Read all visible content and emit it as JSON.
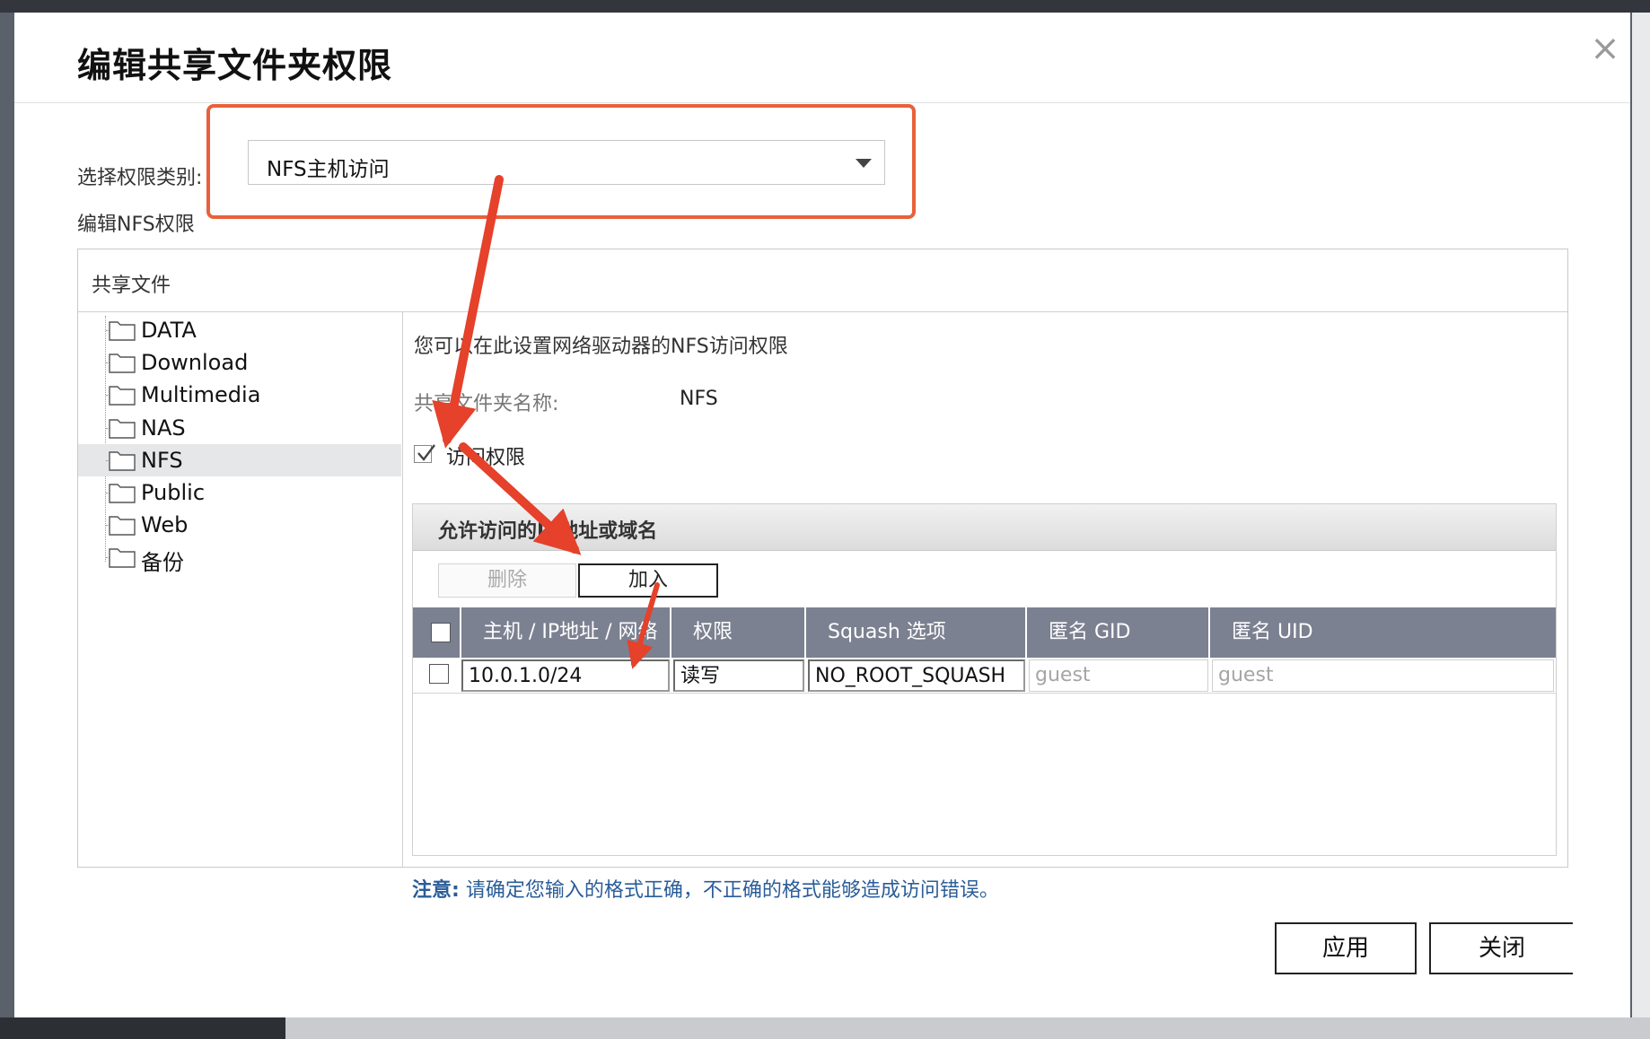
{
  "dialog": {
    "title": "编辑共享文件夹权限",
    "close_glyph": "×"
  },
  "category": {
    "label": "选择权限类别:",
    "selected": "NFS主机访问"
  },
  "edit_label": "编辑NFS权限",
  "panel": {
    "header": "共享文件",
    "folders": [
      {
        "name": "DATA",
        "selected": false
      },
      {
        "name": "Download",
        "selected": false
      },
      {
        "name": "Multimedia",
        "selected": false
      },
      {
        "name": "NAS",
        "selected": false
      },
      {
        "name": "NFS",
        "selected": true
      },
      {
        "name": "Public",
        "selected": false
      },
      {
        "name": "Web",
        "selected": false
      },
      {
        "name": "备份",
        "selected": false
      }
    ]
  },
  "detail": {
    "description": "您可以在此设置网络驱动器的NFS访问权限",
    "share_name_label": "共享文件夹名称:",
    "share_name_value": "NFS",
    "access_checked": true,
    "access_label": "访问权限",
    "allowed_header": "允许访问的IP地址或域名",
    "delete_button": "删除",
    "add_button": "加入",
    "columns": [
      "主机 / IP地址 / 网络",
      "权限",
      "Squash 选项",
      "匿名 GID",
      "匿名 UID"
    ],
    "rows": [
      {
        "host": "10.0.1.0/24",
        "permission": "读写",
        "squash": "NO_ROOT_SQUASH",
        "gid_placeholder": "guest",
        "uid_placeholder": "guest"
      }
    ],
    "note_prefix": "注意:",
    "note_text": "请确定您输入的格式正确，不正确的格式能够造成访问错误。"
  },
  "footer": {
    "apply": "应用",
    "close": "关闭"
  },
  "colors": {
    "highlight": "#e8613a",
    "arrow": "#e5412b",
    "grid_header": "#7c8191",
    "note": "#2a5d99"
  }
}
